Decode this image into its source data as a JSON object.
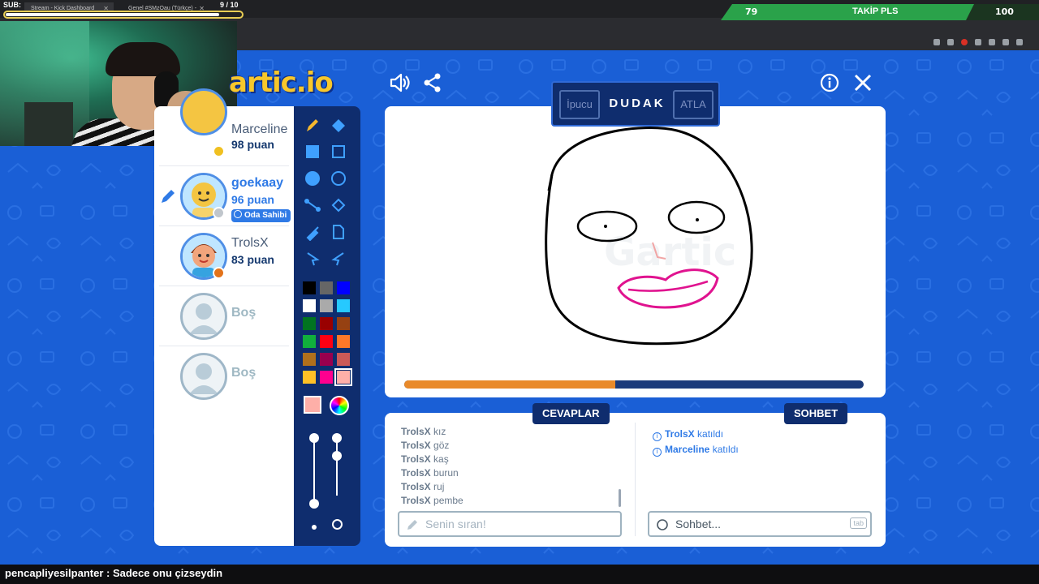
{
  "browser": {
    "tabs": [
      {
        "label": "Stream - Kick Dashboard"
      },
      {
        "label": "Genel #SMzOau (Türkçe) - Gartic.io"
      }
    ]
  },
  "overlay": {
    "sub_label": "SUB:",
    "sub_count": "9  / 10",
    "sub_progress": 0.9,
    "follow_current": "79",
    "follow_title": "TAKİP PLS",
    "follow_goal": "100"
  },
  "game": {
    "logo": "artic.io",
    "colors": {
      "bg": "#1a5fd6",
      "navy": "#0f2d6e",
      "accent": "#2f7ae6",
      "timer": "#e98a2a"
    },
    "top_icons": [
      "sound-icon",
      "share-icon",
      "info-icon",
      "close-icon"
    ],
    "word": {
      "hint": "İpucu",
      "text": "DUDAK",
      "skip": "ATLA"
    },
    "timer_progress": 0.46,
    "players": [
      {
        "name": "Marceline",
        "score": "98 puan",
        "dot": "#f0c020"
      },
      {
        "name": "goekaay",
        "score": "96 puan",
        "tag": "Oda Sahibi",
        "dot": "#c0c6cc",
        "active": true
      },
      {
        "name": "TrolsX",
        "score": "83 puan",
        "dot": "#e3731a"
      },
      {
        "name": "Boş"
      },
      {
        "name": "Boş"
      }
    ],
    "palette": [
      "#000000",
      "#666666",
      "#0000ff",
      "#ffffff",
      "#aaaaaa",
      "#26c9ff",
      "#017420",
      "#990000",
      "#964112",
      "#11b03c",
      "#ff0013",
      "#ff7829",
      "#b0701c",
      "#99004e",
      "#cb5a57",
      "#ffc126",
      "#ff008f",
      "#feafa8"
    ],
    "current_color": "#feafa8"
  },
  "answers": {
    "tab": "CEVAPLAR",
    "items": [
      {
        "user": "TrolsX",
        "text": "kız"
      },
      {
        "user": "TrolsX",
        "text": "göz"
      },
      {
        "user": "TrolsX",
        "text": "kaş"
      },
      {
        "user": "TrolsX",
        "text": "burun"
      },
      {
        "user": "TrolsX",
        "text": "ruj"
      },
      {
        "user": "TrolsX",
        "text": "pembe"
      }
    ],
    "placeholder": "Senin sıran!"
  },
  "chat": {
    "tab": "SOHBET",
    "items": [
      {
        "user": "TrolsX",
        "text": "katıldı"
      },
      {
        "user": "Marceline",
        "text": "katıldı"
      }
    ],
    "placeholder": "Sohbet...",
    "key_hint": "tab"
  },
  "stream_chat": {
    "user": "pencapliyesilpanter",
    "message": "Sadece onu çizseydin"
  }
}
